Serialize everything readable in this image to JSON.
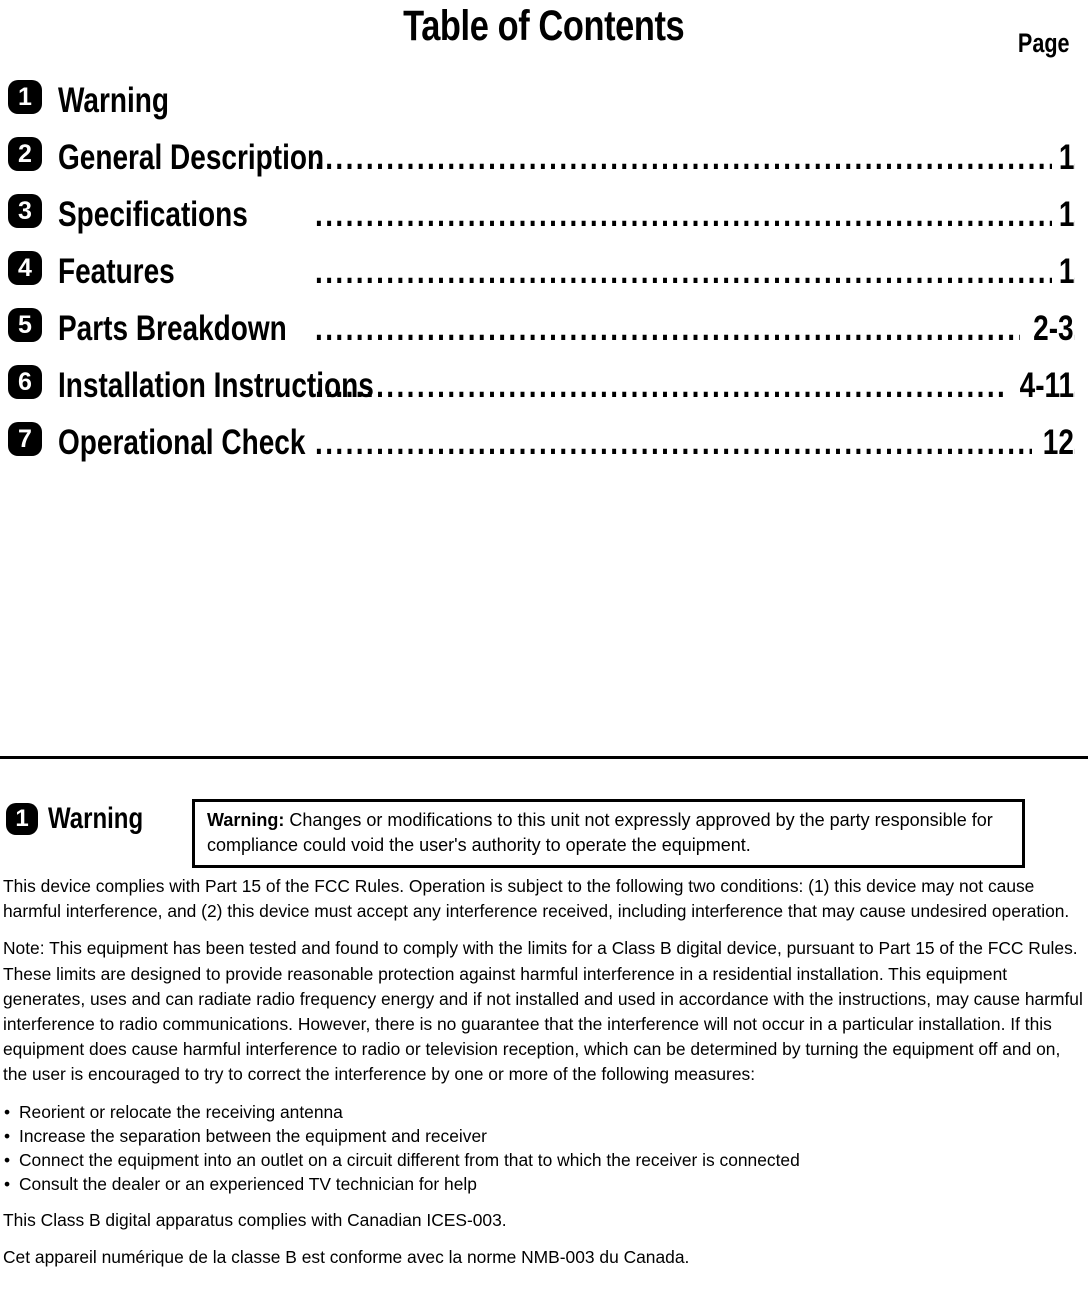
{
  "document": {
    "title": "Table of Contents",
    "page_column_header": "Page"
  },
  "toc": {
    "entries": [
      {
        "number": "1",
        "label": "Warning",
        "page": "",
        "has_leader": false
      },
      {
        "number": "2",
        "label": "General Description",
        "page": "1",
        "has_leader": true
      },
      {
        "number": "3",
        "label": "Specifications",
        "page": "1",
        "has_leader": true
      },
      {
        "number": "4",
        "label": "Features",
        "page": "1",
        "has_leader": true
      },
      {
        "number": "5",
        "label": "Parts Breakdown",
        "page": "2-3",
        "has_leader": true
      },
      {
        "number": "6",
        "label": "Installation Instructions",
        "page": "4-11",
        "has_leader": true
      },
      {
        "number": "7",
        "label": "Operational Check",
        "page": "12",
        "has_leader": true
      }
    ],
    "leader_dots": "....................................................................................................."
  },
  "warning_section": {
    "number": "1",
    "heading": "Warning",
    "callout": {
      "bold_lead": "Warning:",
      "text": " Changes or modifications to this unit not expressly approved by the party responsible for compliance could void the user's authority to operate the equipment."
    },
    "paragraphs": [
      "This device complies with Part 15 of the FCC Rules. Operation is subject to the following two conditions: (1) this device may not cause harmful interference, and (2) this device must accept any interference received, including interference that may cause undesired operation.",
      "Note: This equipment has been tested and found to comply with the limits for a Class B digital device, pursuant to Part 15 of the FCC Rules. These limits are designed to provide reasonable protection against harmful interference in a residential installation. This equipment generates, uses and can radiate radio frequency energy and if not installed and used in accordance with the instructions, may cause harmful interference to radio communications. However, there is no guarantee that the interference will not occur in a particular installation. If this equipment does cause harmful interference to radio or television reception, which can be determined by turning the equipment off and on, the user is encouraged to try to correct the interference by one or more of the following measures:"
    ],
    "bullet_marker": "•",
    "bullets": [
      "Reorient or relocate the receiving antenna",
      "Increase the separation between the equipment and receiver",
      "Connect the equipment into an outlet on a circuit different from that to which the receiver is connected",
      "Consult the dealer or an experienced TV technician for help"
    ],
    "closing_paragraphs": [
      "This Class B digital apparatus complies with Canadian ICES-003.",
      "Cet appareil numérique de la classe B est conforme avec la norme NMB-003 du Canada."
    ]
  },
  "colors": {
    "ink": "#000000",
    "paper": "#ffffff"
  }
}
